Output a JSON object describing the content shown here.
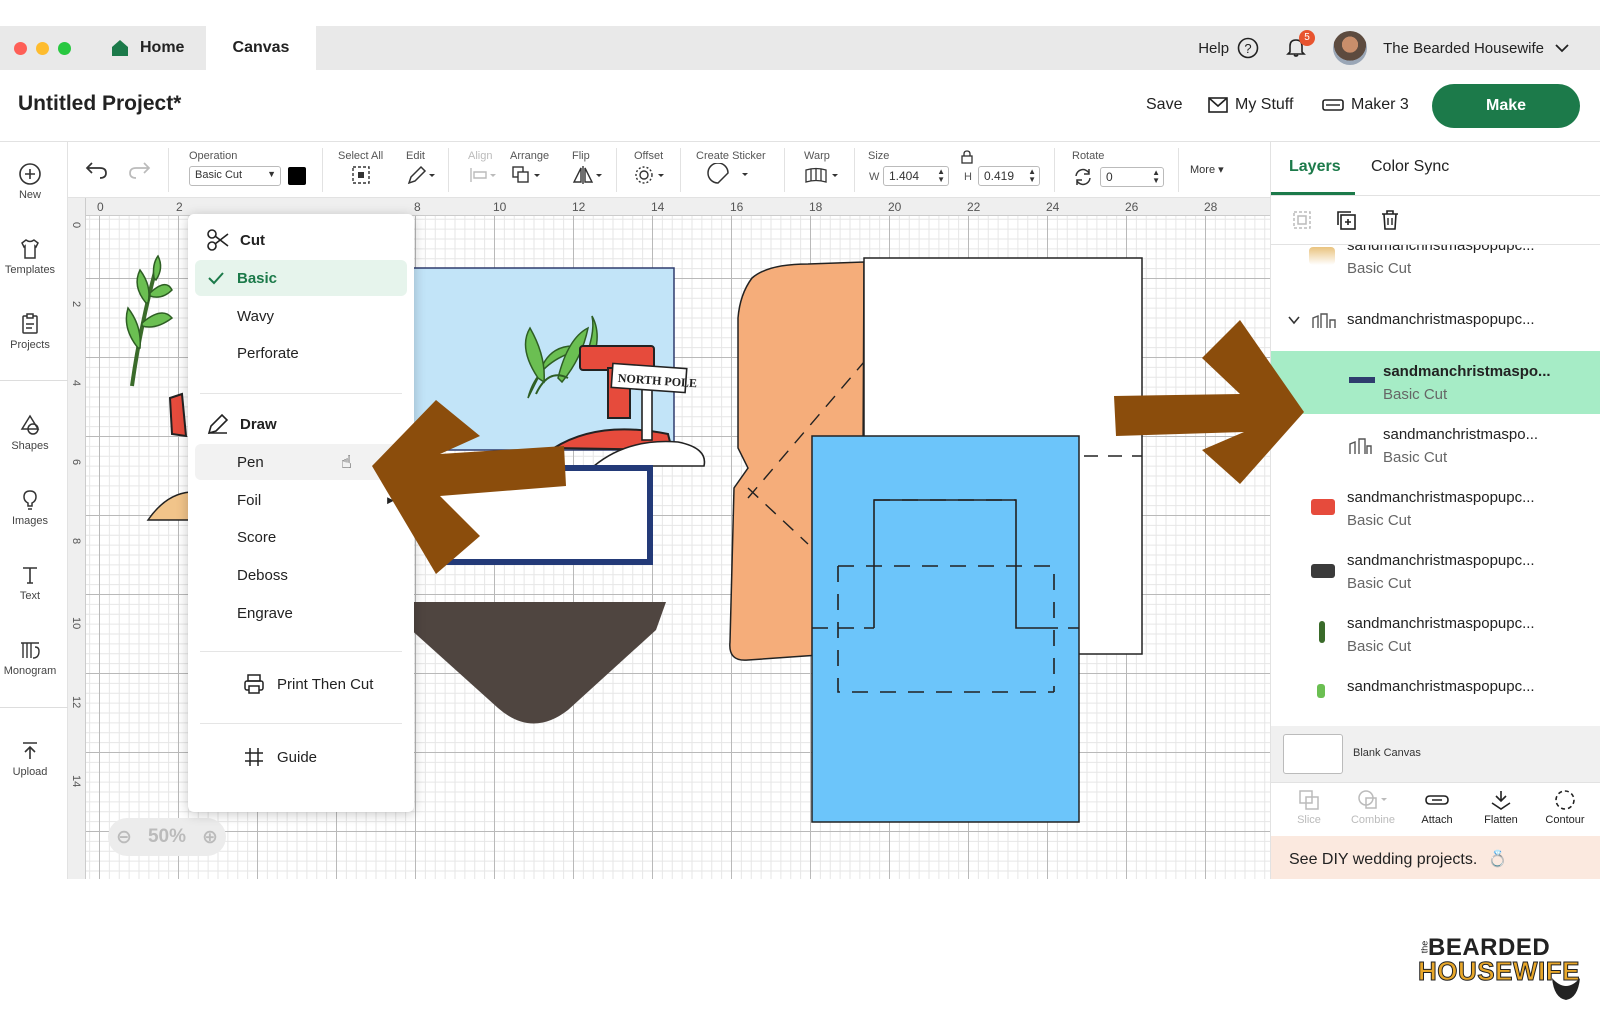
{
  "tabs": {
    "home": "Home",
    "canvas": "Canvas"
  },
  "topbar": {
    "help": "Help",
    "notification_count": "5",
    "user_name": "The Bearded Housewife"
  },
  "header": {
    "project_title": "Untitled Project*",
    "save": "Save",
    "my_stuff": "My Stuff",
    "machine": "Maker 3",
    "make": "Make"
  },
  "leftnav": {
    "items": [
      "New",
      "Templates",
      "Projects",
      "Shapes",
      "Images",
      "Text",
      "Monogram",
      "Upload"
    ]
  },
  "toolbar": {
    "operation_label": "Operation",
    "operation_value": "Basic Cut",
    "select_all": "Select All",
    "edit": "Edit",
    "align": "Align",
    "arrange": "Arrange",
    "flip": "Flip",
    "offset": "Offset",
    "create_sticker": "Create Sticker",
    "warp": "Warp",
    "size": "Size",
    "w_label": "W",
    "w_value": "1.404",
    "h_label": "H",
    "h_value": "0.419",
    "rotate": "Rotate",
    "rotate_value": "0",
    "more": "More"
  },
  "ruler": {
    "top": [
      "0",
      "2",
      "8",
      "10",
      "12",
      "14",
      "16",
      "18",
      "20",
      "22",
      "24",
      "26",
      "28"
    ],
    "left": [
      "0",
      "2",
      "4",
      "6",
      "8",
      "10",
      "12",
      "14"
    ]
  },
  "zoom": "50%",
  "dropdown": {
    "cut_header": "Cut",
    "cut_items": [
      "Basic",
      "Wavy",
      "Perforate"
    ],
    "draw_header": "Draw",
    "draw_items": [
      "Pen",
      "Foil",
      "Score",
      "Deboss",
      "Engrave"
    ],
    "print_then_cut": "Print Then Cut",
    "guide": "Guide",
    "selected": "Basic"
  },
  "canvas_art": {
    "sign_text": "NORTH POLE"
  },
  "panel": {
    "tabs": [
      "Layers",
      "Color Sync"
    ],
    "layers": [
      {
        "name": "sandmanchristmaspopupc...",
        "sub": "Basic Cut"
      },
      {
        "name": "sandmanchristmaspopupc...",
        "sub": ""
      },
      {
        "name": "sandmanchristmaspo...",
        "sub": "Basic Cut"
      },
      {
        "name": "sandmanchristmaspo...",
        "sub": "Basic Cut"
      },
      {
        "name": "sandmanchristmaspopupc...",
        "sub": "Basic Cut"
      },
      {
        "name": "sandmanchristmaspopupc...",
        "sub": "Basic Cut"
      },
      {
        "name": "sandmanchristmaspopupc...",
        "sub": "Basic Cut"
      },
      {
        "name": "sandmanchristmaspopupc...",
        "sub": ""
      }
    ],
    "blank_canvas": "Blank Canvas",
    "tools": [
      "Slice",
      "Combine",
      "Attach",
      "Flatten",
      "Contour"
    ],
    "promo": "See DIY wedding projects."
  },
  "logo": {
    "line1": "BEARDED",
    "line2": "HOUSEWIFE",
    "prefix": "the"
  },
  "colors": {
    "make_green": "#1c7a4a",
    "selected_layer": "#a6ecc6",
    "arrow_brown": "#8b4d0c",
    "orange_card": "#f5ad7a",
    "blue_card": "#6cc5fa",
    "navy": "#233a78"
  }
}
